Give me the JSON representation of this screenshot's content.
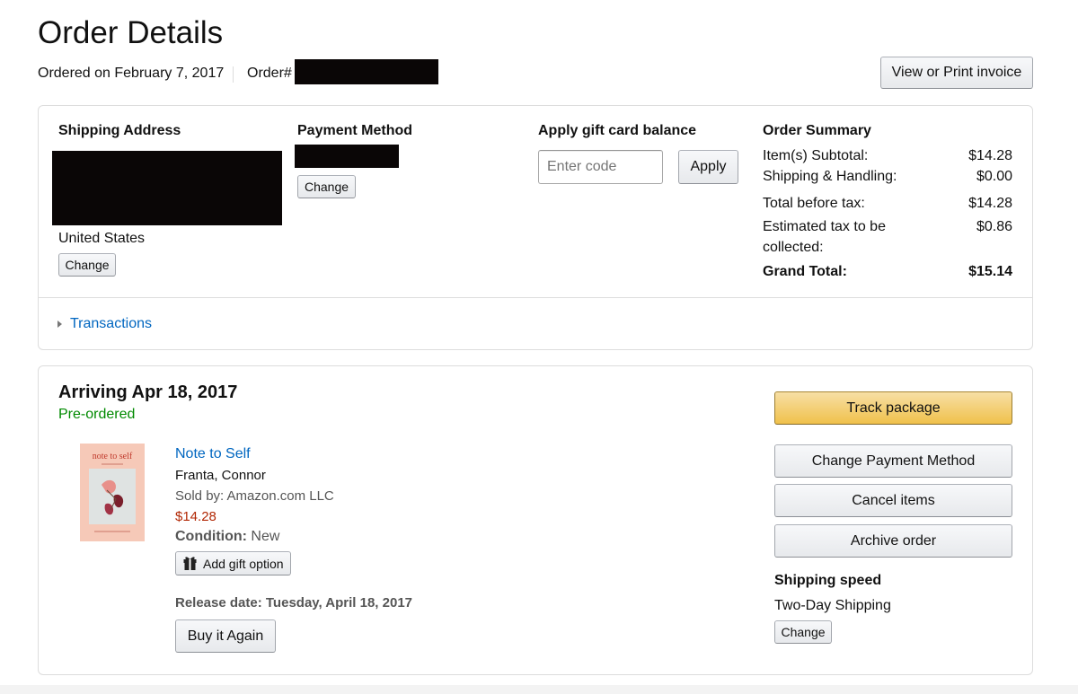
{
  "header": {
    "title": "Order Details",
    "ordered_on": "Ordered on February 7, 2017",
    "order_label": "Order#",
    "invoice_button": "View or Print invoice"
  },
  "summary_panel": {
    "shipping": {
      "heading": "Shipping Address",
      "country": "United States",
      "change": "Change"
    },
    "payment": {
      "heading": "Payment Method",
      "change": "Change"
    },
    "gift_card": {
      "heading": "Apply gift card balance",
      "placeholder": "Enter code",
      "apply": "Apply"
    },
    "order_summary": {
      "heading": "Order Summary",
      "subtotal_label": "Item(s) Subtotal:",
      "subtotal": "$14.28",
      "shipping_label": "Shipping & Handling:",
      "shipping_value": "$0.00",
      "before_tax_label": "Total before tax:",
      "before_tax": "$14.28",
      "tax_label_1": "Estimated tax to be",
      "tax_label_2": "collected:",
      "tax": "$0.86",
      "grand_label": "Grand Total:",
      "grand": "$15.14"
    },
    "transactions": "Transactions"
  },
  "shipment": {
    "arriving": "Arriving Apr 18, 2017",
    "status": "Pre-ordered",
    "status_color": "#008a00",
    "item": {
      "cover_title": "note to self",
      "title": "Note to Self",
      "author": "Franta, Connor",
      "sold_by": "Sold by: Amazon.com LLC",
      "price": "$14.28",
      "price_color": "#b12704",
      "condition_label": "Condition:",
      "condition": "New",
      "gift_option": "Add gift option",
      "release": "Release date: Tuesday, April 18, 2017",
      "buy_again": "Buy it Again"
    },
    "actions": {
      "track": "Track package",
      "change_payment": "Change Payment Method",
      "cancel": "Cancel items",
      "archive": "Archive order"
    },
    "shipping_speed": {
      "heading": "Shipping speed",
      "value": "Two-Day Shipping",
      "change": "Change"
    }
  }
}
